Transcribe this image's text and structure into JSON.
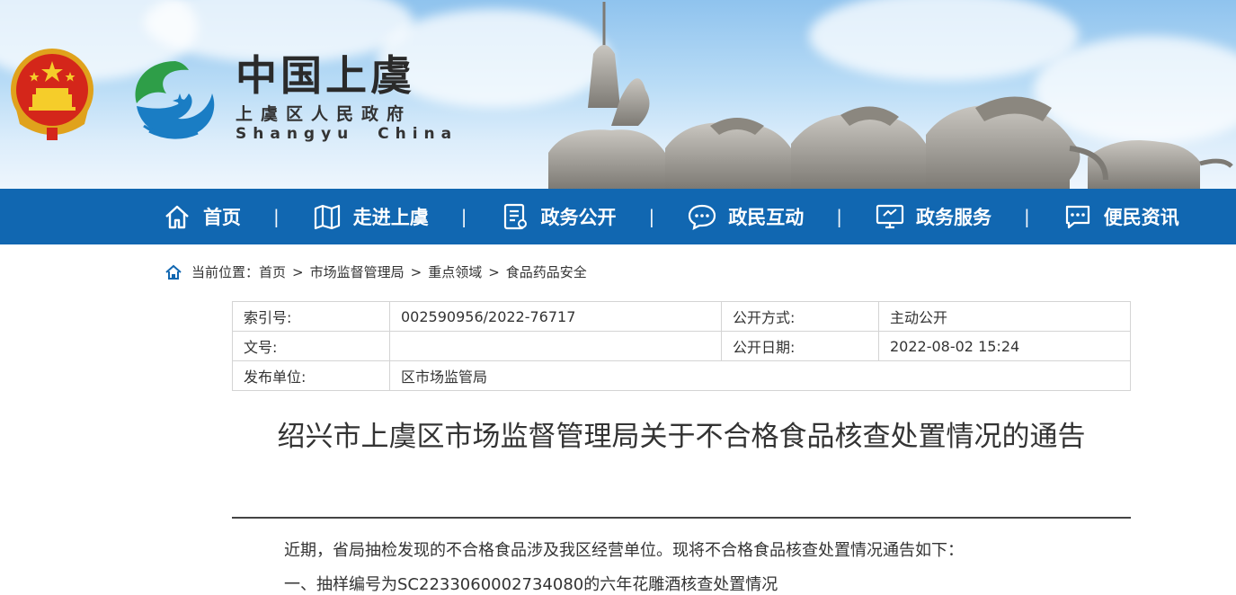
{
  "banner": {
    "logo_title": "中国上虞",
    "logo_subtitle": "上虞区人民政府",
    "logo_english": "Shangyu  China"
  },
  "nav": {
    "items": [
      {
        "label": "首页",
        "icon": "home-icon"
      },
      {
        "label": "走进上虞",
        "icon": "map-icon"
      },
      {
        "label": "政务公开",
        "icon": "document-icon"
      },
      {
        "label": "政民互动",
        "icon": "chat-icon"
      },
      {
        "label": "政务服务",
        "icon": "monitor-icon"
      },
      {
        "label": "便民资讯",
        "icon": "message-icon"
      }
    ],
    "separator": "|"
  },
  "breadcrumb": {
    "prefix": "当前位置：",
    "items": [
      "首页",
      "市场监督管理局",
      "重点领域",
      "食品药品安全"
    ],
    "separator": ">"
  },
  "meta": {
    "index_label": "索引号:",
    "index_value": "002590956/2022-76717",
    "open_mode_label": "公开方式:",
    "open_mode_value": "主动公开",
    "doc_no_label": "文号:",
    "doc_no_value": "",
    "open_date_label": "公开日期:",
    "open_date_value": "2022-08-02 15:24",
    "issuer_label": "发布单位:",
    "issuer_value": "区市场监管局"
  },
  "article": {
    "title": "绍兴市上虞区市场监督管理局关于不合格食品核查处置情况的通告",
    "paragraphs": [
      "近期，省局抽检发现的不合格食品涉及我区经营单位。现将不合格食品核查处置情况通告如下：",
      "一、抽样编号为SC22330600027340​80的六年花雕酒核查处置情况"
    ]
  },
  "colors": {
    "nav_bg": "#1167b1",
    "text": "#333333"
  }
}
